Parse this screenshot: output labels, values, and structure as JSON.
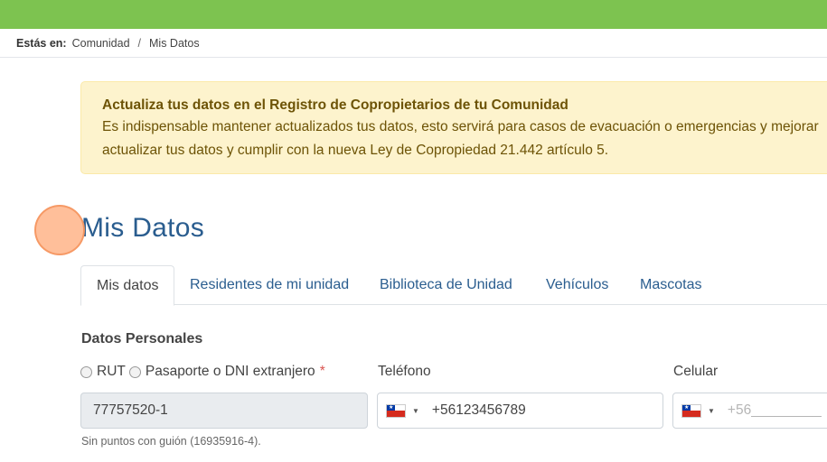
{
  "colors": {
    "topbar": "#7dc350",
    "link": "#2a5d8f",
    "alert_bg": "#fdf3cd",
    "alert_text": "#6d5306"
  },
  "breadcrumb": {
    "label": "Estás en:",
    "items": [
      "Comunidad",
      "Mis Datos"
    ],
    "separator": "/"
  },
  "alert": {
    "title": "Actualiza tus datos en el Registro de Copropietarios de tu Comunidad",
    "line1": "Es indispensable mantener actualizados tus datos, esto servirá para casos de evacuación o emergencias y mejorar",
    "line2": "actualizar tus datos y cumplir con la nueva Ley de Copropiedad 21.442 artículo 5."
  },
  "page_title": "Mis Datos",
  "tabs": [
    {
      "label": "Mis datos",
      "active": true
    },
    {
      "label": "Residentes de mi unidad",
      "active": false
    },
    {
      "label": "Biblioteca de Unidad",
      "active": false
    },
    {
      "label": "Vehículos",
      "active": false
    },
    {
      "label": "Mascotas",
      "active": false
    }
  ],
  "form": {
    "section_title": "Datos Personales",
    "id_type": {
      "option1": "RUT",
      "option2": "Pasaporte o DNI extranjero",
      "required_mark": "*"
    },
    "id_value": "77757520-1",
    "id_hint": "Sin puntos con guión (16935916-4).",
    "phone": {
      "label": "Teléfono",
      "value": "+56123456789",
      "flag_icon": "chile-flag-icon"
    },
    "mobile": {
      "label": "Celular",
      "placeholder": "+56_________",
      "flag_icon": "chile-flag-icon"
    }
  }
}
